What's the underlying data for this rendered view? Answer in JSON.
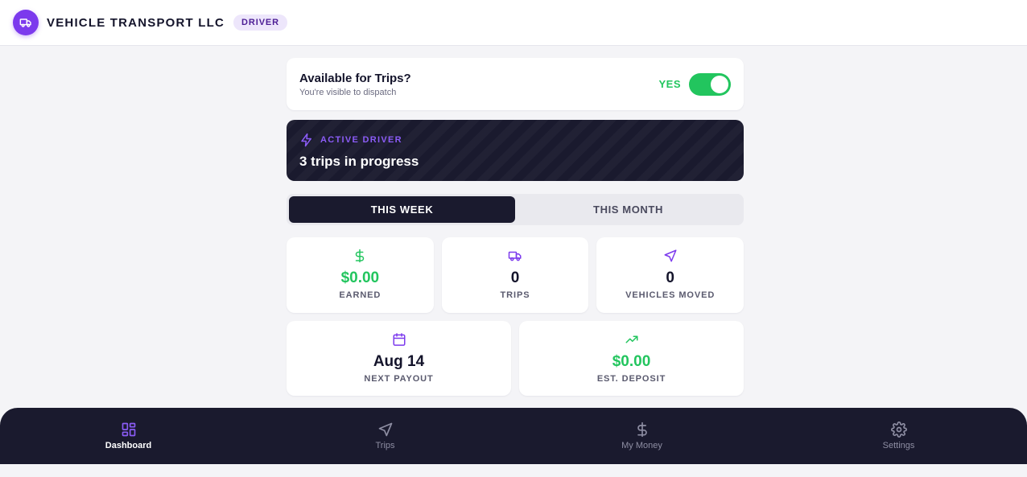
{
  "header": {
    "company": "VEHICLE TRANSPORT LLC",
    "role_badge": "DRIVER",
    "logo_icon": "truck-icon"
  },
  "availability": {
    "title": "Available for Trips?",
    "subtitle": "You're visible to dispatch",
    "state_label": "YES",
    "enabled": true
  },
  "active_driver": {
    "label": "ACTIVE DRIVER",
    "text": "3 trips in progress",
    "icon": "lightning-icon"
  },
  "period_tabs": [
    {
      "label": "THIS WEEK",
      "active": true
    },
    {
      "label": "THIS MONTH",
      "active": false
    }
  ],
  "stats": {
    "earned": {
      "value": "$0.00",
      "label": "EARNED",
      "icon": "dollar-icon"
    },
    "trips": {
      "value": "0",
      "label": "TRIPS",
      "icon": "truck-icon"
    },
    "vehicles_moved": {
      "value": "0",
      "label": "VEHICLES MOVED",
      "icon": "navigation-icon"
    },
    "next_payout": {
      "value": "Aug 14",
      "label": "NEXT PAYOUT",
      "icon": "calendar-icon"
    },
    "est_deposit": {
      "value": "$0.00",
      "label": "EST. DEPOSIT",
      "icon": "trending-up-icon"
    }
  },
  "bottom_nav": [
    {
      "label": "Dashboard",
      "icon": "dashboard-icon",
      "active": true
    },
    {
      "label": "Trips",
      "icon": "navigation-icon",
      "active": false
    },
    {
      "label": "My Money",
      "icon": "dollar-icon",
      "active": false
    },
    {
      "label": "Settings",
      "icon": "gear-icon",
      "active": false
    }
  ],
  "colors": {
    "accent": "#7c3aed",
    "success": "#22c55e",
    "dark": "#1a1a2e",
    "background": "#f4f4f7"
  }
}
